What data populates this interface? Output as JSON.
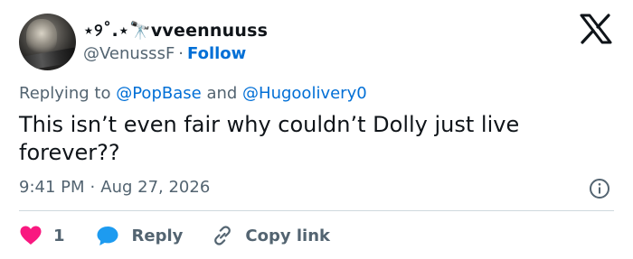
{
  "author": {
    "display_name": "⋆୨˚.⋆🔭vveennuuss",
    "handle": "@VenusssF",
    "separator": "·",
    "follow_label": "Follow"
  },
  "reply_context": {
    "prefix": "Replying to",
    "mention_1": "@PopBase",
    "conjunction": "and",
    "mention_2": "@Hugoolivery0"
  },
  "tweet": {
    "text": "This isn’t even fair why couldn’t Dolly just live forever??",
    "time": "9:41 PM",
    "separator": "·",
    "date": "Aug 27, 2026"
  },
  "actions": {
    "like_count": "1",
    "reply_label": "Reply",
    "copy_label": "Copy link"
  },
  "colors": {
    "link": "#006fd6",
    "muted": "#536471",
    "like": "#f91880",
    "reply_bubble": "#1d9bf0",
    "text": "#0f1419"
  },
  "icons": [
    "x-logo-icon",
    "info-icon",
    "heart-icon",
    "reply-bubble-icon",
    "link-icon"
  ]
}
